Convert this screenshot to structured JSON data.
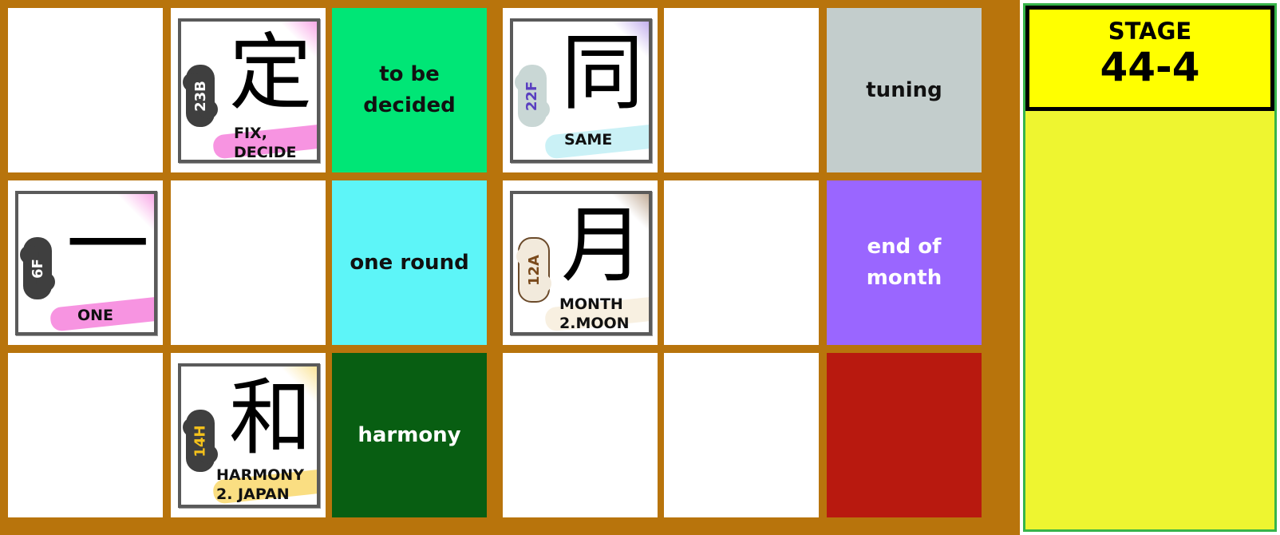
{
  "stage": {
    "label": "STAGE",
    "value": "44-4"
  },
  "colors": {
    "board_frame": "#b8740c",
    "panel_bg": "#eef530",
    "stage_bg": "#ffff00"
  },
  "grid": {
    "row1": {
      "c1": {
        "type": "empty"
      },
      "c2": {
        "type": "kanji",
        "kanji": "定",
        "code": "23B",
        "meaning": "FIX,\nDECIDE",
        "accent": "#f03cc8",
        "brain_color": "#3f3f3f",
        "code_color": "#ffffff"
      },
      "c3": {
        "type": "word",
        "text": "to be\ndecided",
        "bg": "#00e676",
        "fg": "#111111"
      },
      "c4": {
        "type": "kanji",
        "kanji": "同",
        "code": "22F",
        "meaning": "SAME",
        "accent": "#7b4fd6",
        "brain_color": "#c9d7d5",
        "code_color": "#5a3fc0"
      },
      "c5": {
        "type": "empty"
      },
      "c6": {
        "type": "word",
        "text": "tuning",
        "bg": "#c3cdcc",
        "fg": "#111111"
      }
    },
    "row2": {
      "c1": {
        "type": "kanji",
        "kanji": "一",
        "code": "6F",
        "meaning": "ONE",
        "accent": "#f03cc8",
        "brain_color": "#3f3f3f",
        "code_color": "#ffffff"
      },
      "c2": {
        "type": "empty"
      },
      "c3": {
        "type": "word",
        "text": "one round",
        "bg": "#5df5f8",
        "fg": "#111111"
      },
      "c4": {
        "type": "kanji",
        "kanji": "月",
        "code": "12A",
        "meaning": "MONTH\n2.MOON",
        "accent": "#7a4a1c",
        "brain_color": "#f2eadc",
        "code_color": "#7a4a1c"
      },
      "c5": {
        "type": "empty"
      },
      "c6": {
        "type": "word",
        "text": "end of month",
        "bg": "#9a66ff",
        "fg": "#ffffff"
      }
    },
    "row3": {
      "c1": {
        "type": "empty"
      },
      "c2": {
        "type": "kanji",
        "kanji": "和",
        "code": "14H",
        "meaning": "HARMONY\n2. JAPAN",
        "accent": "#f5c21b",
        "brain_color": "#3f3f3f",
        "code_color": "#f5c21b"
      },
      "c3": {
        "type": "word",
        "text": "harmony",
        "bg": "#085e12",
        "fg": "#ffffff"
      },
      "c4": {
        "type": "empty"
      },
      "c5": {
        "type": "empty"
      },
      "c6": {
        "type": "word",
        "text": "",
        "bg": "#b8190f",
        "fg": "#ffffff"
      }
    }
  }
}
